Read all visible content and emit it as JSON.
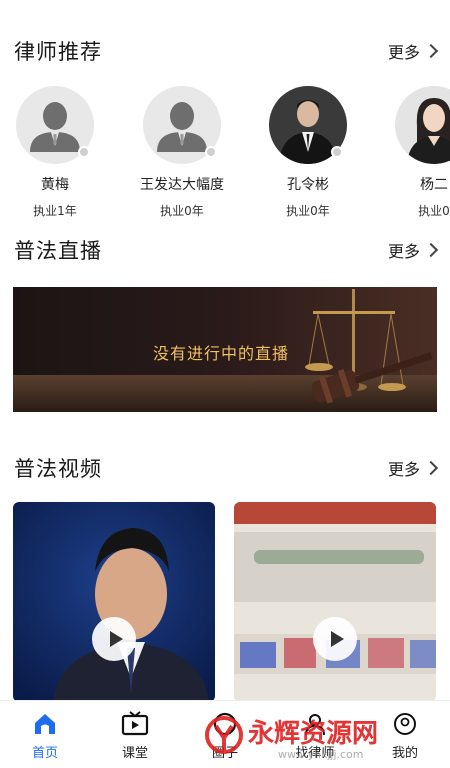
{
  "lawyer_section": {
    "title": "律师推荐",
    "more_label": "更多"
  },
  "lawyers": [
    {
      "name": "黄梅",
      "years": "执业1年",
      "avatar": "default-avatar"
    },
    {
      "name": "王发达大幅度",
      "years": "执业0年",
      "avatar": "default-avatar"
    },
    {
      "name": "孔令彬",
      "years": "执业0年",
      "avatar": "photo-male"
    },
    {
      "name": "杨二",
      "years": "执业0",
      "avatar": "photo-female"
    }
  ],
  "live_section": {
    "title": "普法直播",
    "more_label": "更多",
    "banner_text": "没有进行中的直播"
  },
  "video_section": {
    "title": "普法视频",
    "more_label": "更多"
  },
  "videos": [
    {
      "thumbnail": "news-anchor-man"
    },
    {
      "thumbnail": "screen-text-blurred"
    }
  ],
  "tabbar": {
    "tabs": [
      {
        "label": "首页",
        "icon": "home-icon",
        "active": true
      },
      {
        "label": "课堂",
        "icon": "tv-icon",
        "active": false
      },
      {
        "label": "圈子",
        "icon": "circle-icon",
        "active": false
      },
      {
        "label": "找律师",
        "icon": "lawyer-icon",
        "active": false
      },
      {
        "label": "我的",
        "icon": "profile-icon",
        "active": false
      }
    ]
  },
  "watermark": {
    "text": "永辉资源网",
    "sub": "www.yhkjjj.com"
  },
  "colors": {
    "accent": "#1e6df0",
    "watermark": "#e02020"
  }
}
